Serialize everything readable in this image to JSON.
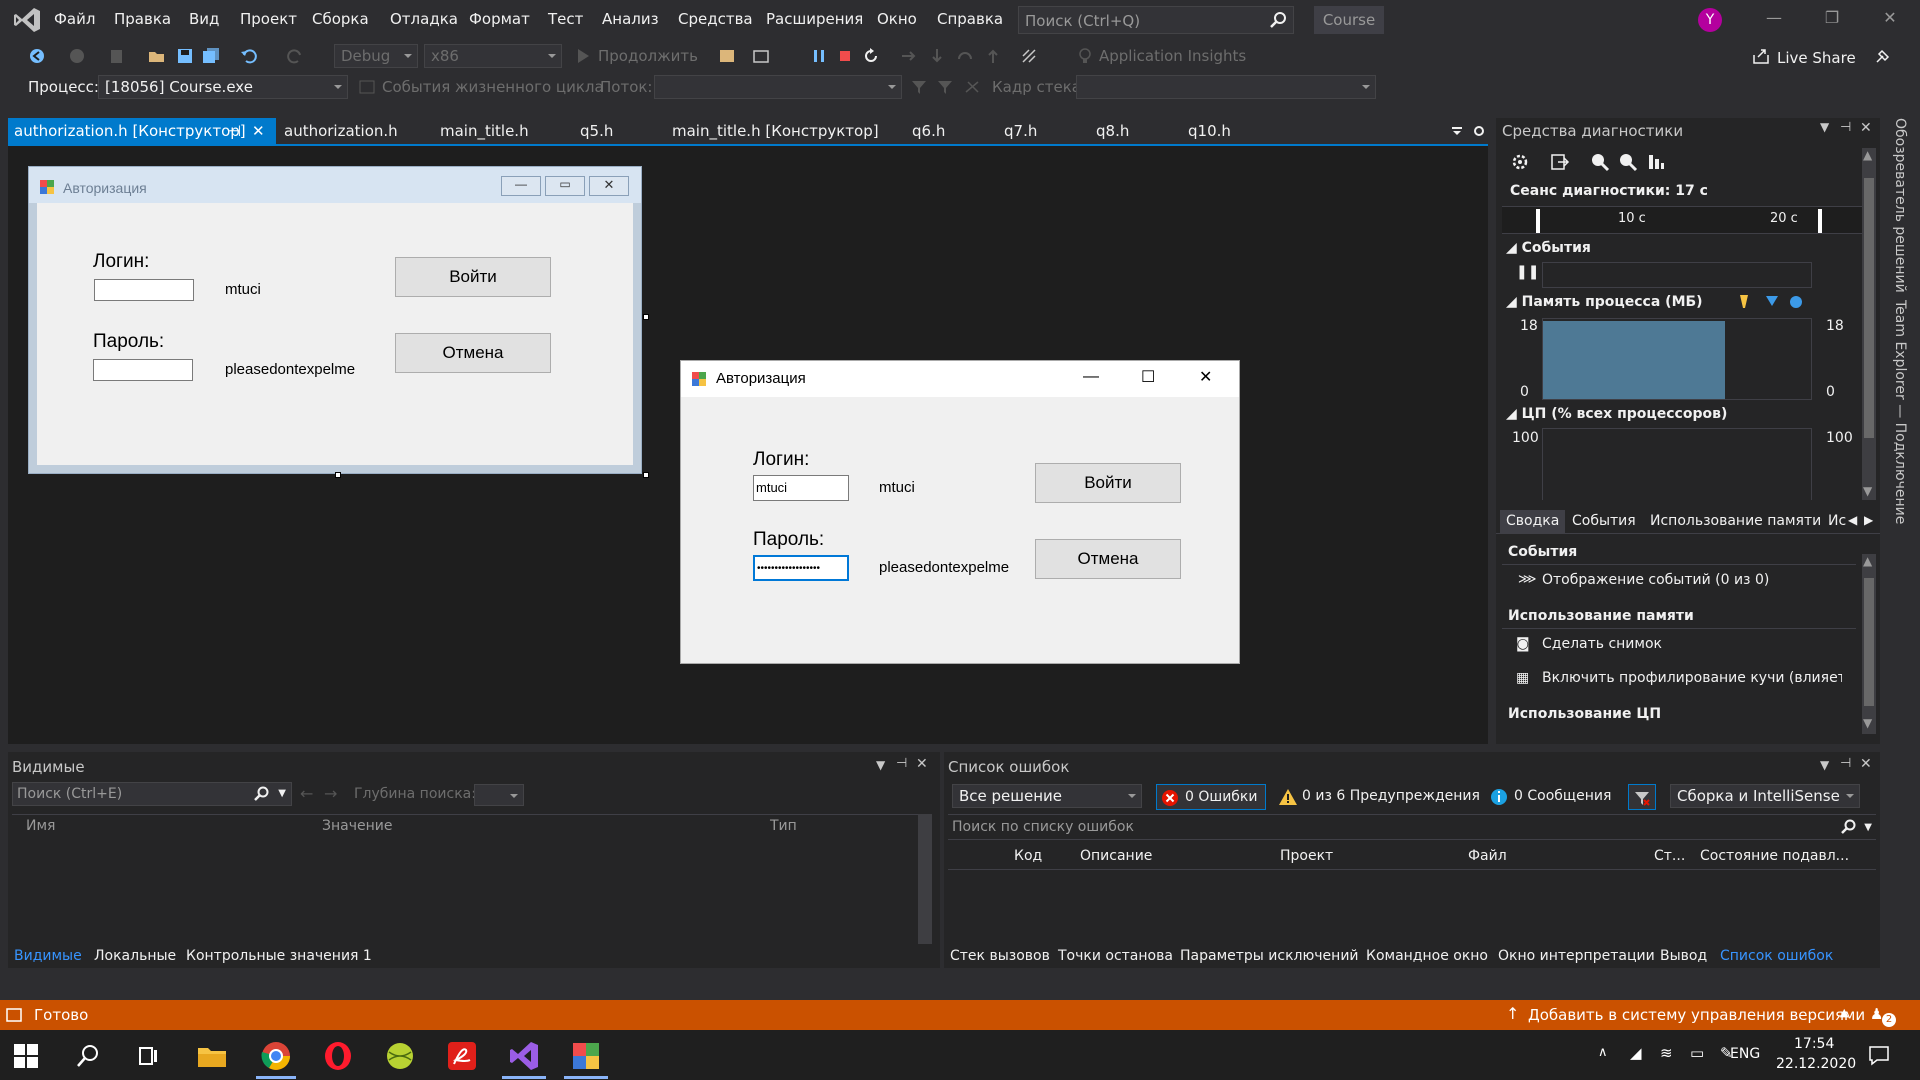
{
  "menu": [
    "Файл",
    "Правка",
    "Вид",
    "Проект",
    "Сборка",
    "Отладка",
    "Формат",
    "Тест",
    "Анализ",
    "Средства",
    "Расширения",
    "Окно",
    "Справка"
  ],
  "quick_search": {
    "placeholder": "Поиск (Ctrl+Q)"
  },
  "solution_name": "Course",
  "user_initial": "Y",
  "toolbar": {
    "config": "Debug",
    "platform": "x86",
    "continue_label": "Продолжить",
    "app_insights": "Application Insights",
    "live_share": "Live Share",
    "process_label": "Процесс:",
    "process_value": "[18056] Course.exe",
    "lifecycle_label": "События жизненного цикла",
    "thread_label": "Поток:",
    "stackframe_label": "Кадр стека:"
  },
  "doc_tabs": [
    "authorization.h [Конструктор]",
    "authorization.h",
    "main_title.h",
    "q5.h",
    "main_title.h [Конструктор]",
    "q6.h",
    "q7.h",
    "q8.h",
    "q10.h"
  ],
  "form": {
    "title": "Авторизация",
    "login_label": "Логин:",
    "password_label": "Пароль:",
    "login_hint": "mtuci",
    "password_hint": "pleasedontexpelme",
    "login_button": "Войти",
    "cancel_button": "Отмена",
    "running_login_value": "mtuci",
    "running_password_value": "••••••••••••••••••"
  },
  "diagnostics": {
    "title": "Средства диагностики",
    "session": "Сеанс диагностики: 17 с",
    "tick_10": "10 с",
    "tick_20": "20 с",
    "events_section": "События",
    "memory_section": "Память процесса (МБ)",
    "memory_max": "18",
    "memory_min": "0",
    "memory_fill": 0.98,
    "cpu_section": "ЦП (% всех процессоров)",
    "cpu_max": "100",
    "tabs": [
      "Сводка",
      "События",
      "Использование памяти",
      "Ис"
    ],
    "summary_events": "События",
    "show_events": "Отображение событий (0 из 0)",
    "memory_usage": "Использование памяти",
    "take_snapshot": "Сделать снимок",
    "heap_profiling": "Включить профилирование кучи (влияет на",
    "cpu_usage": "Использование ЦП"
  },
  "side_rail": [
    "Обозреватель решений",
    "Team Explorer — Подключение"
  ],
  "locals": {
    "title": "Видимые",
    "search_placeholder": "Поиск (Ctrl+E)",
    "depth_label": "Глубина поиска:",
    "columns": [
      "Имя",
      "Значение",
      "Тип"
    ],
    "tabs": [
      "Видимые",
      "Локальные",
      "Контрольные значения 1"
    ]
  },
  "errors": {
    "title": "Список ошибок",
    "scope": "Все решение",
    "errors_count": "0 Ошибки",
    "warnings_count": "0 из 6 Предупреждения",
    "messages_count": "0 Сообщения",
    "source": "Сборка и IntelliSense",
    "search_placeholder": "Поиск по списку ошибок",
    "columns": [
      "Код",
      "Описание",
      "Проект",
      "Файл",
      "Ст...",
      "Состояние подавл..."
    ],
    "tabs": [
      "Стек вызовов",
      "Точки останова",
      "Параметры исключений",
      "Командное окно",
      "Окно интерпретации",
      "Вывод",
      "Список ошибок"
    ]
  },
  "status": {
    "ready": "Готово",
    "source_control": "Добавить в систему управления версиями",
    "notifications": "2"
  },
  "taskbar": {
    "lang": "ENG",
    "time": "17:54",
    "date": "22.12.2020"
  },
  "colors": {
    "accent": "#007acc",
    "status": "#ca5100",
    "memory_bar": "#4e7995"
  }
}
